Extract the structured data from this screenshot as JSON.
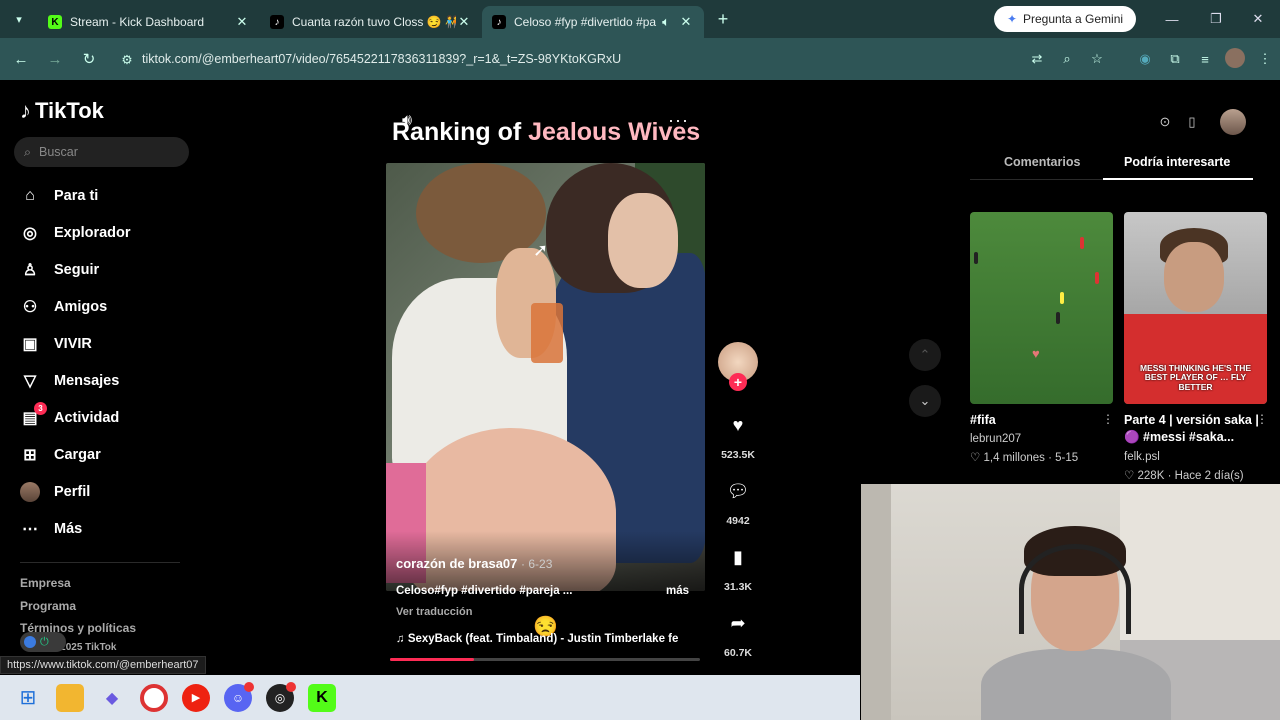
{
  "browser": {
    "tabs": [
      {
        "title": "Stream - Kick Dashboard",
        "favicon": "K",
        "active": false
      },
      {
        "title": "Cuanta razón tuvo Closs 😏 🧑‍🤝‍🧑 #",
        "favicon": "♪",
        "active": false
      },
      {
        "title": "Celoso #fyp #divertido #pa",
        "favicon": "♪",
        "active": true
      }
    ],
    "gemini_label": "Pregunta a Gemini",
    "url": "tiktok.com/@emberheart07/video/7654522117836311839?_r=1&_t=ZS-98YKtoKGRxU",
    "status_url": "https://www.tiktok.com/@emberheart07"
  },
  "sidebar": {
    "logo": "TikTok",
    "search_placeholder": "Buscar",
    "items": [
      {
        "label": "Para ti",
        "icon": "home-icon"
      },
      {
        "label": "Explorador",
        "icon": "compass-icon"
      },
      {
        "label": "Seguir",
        "icon": "user-follow-icon"
      },
      {
        "label": "Amigos",
        "icon": "friends-icon"
      },
      {
        "label": "VIVIR",
        "icon": "live-icon"
      },
      {
        "label": "Mensajes",
        "icon": "messages-icon"
      },
      {
        "label": "Actividad",
        "icon": "activity-icon",
        "badge": "3"
      },
      {
        "label": "Cargar",
        "icon": "upload-icon"
      },
      {
        "label": "Perfil",
        "icon": "profile-avatar"
      },
      {
        "label": "Más",
        "icon": "more-icon"
      }
    ],
    "footer": [
      "Empresa",
      "Programa",
      "Términos y políticas"
    ],
    "footer_small": "© 2025 TikTok"
  },
  "video": {
    "title_prefix": "Ranking of ",
    "title_highlight": "Jealous Wives",
    "author": "corazón de brasa07",
    "date": "· 6-23",
    "caption": "Celoso#fyp #divertido #pareja ...",
    "more": "más",
    "translate": "Ver traducción",
    "music": "SexyBack (feat. Timbaland) - Justin Timberlake fe",
    "progress": 0.27,
    "likes": "523.5K",
    "comments": "4942",
    "saves": "31.3K",
    "shares": "60.7K"
  },
  "panel": {
    "tab_comments": "Comentarios",
    "tab_related": "Podría interesarte",
    "cards": [
      {
        "title": "#fifa",
        "author": "lebrun207",
        "views": "1,4 millones",
        "date": "5-15"
      },
      {
        "title": "Parte 4 | versión saka | 🟣 #messi #saka...",
        "author": "felk.psl",
        "views": "228K",
        "date": "Hace 2 día(s)",
        "thumb_text": "MESSI THINKING HE'S THE BEST PLAYER OF … FLY BETTER"
      }
    ]
  },
  "colors": {
    "accent": "#fe2c55",
    "tabbar": "#1f3a3b",
    "addrbar": "#2e5556"
  }
}
